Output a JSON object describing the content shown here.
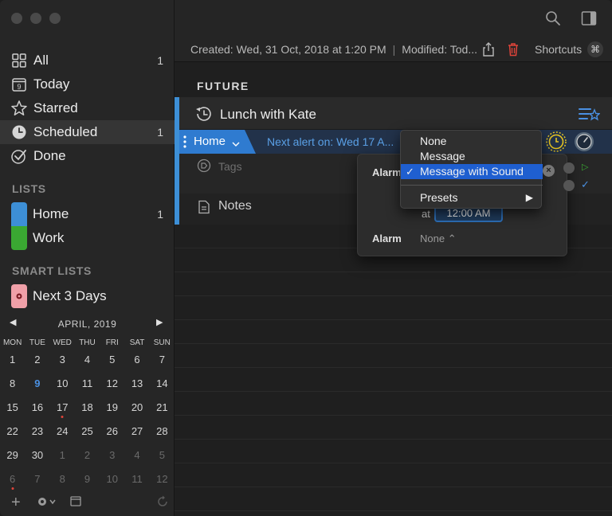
{
  "toolbar": {
    "add_icon": "plus-icon",
    "search_icon": "search-icon",
    "sidebar_toggle_icon": "sidebar-toggle-icon"
  },
  "sidebar": {
    "items": [
      {
        "label": "All",
        "count": "1",
        "icon": "grid-icon"
      },
      {
        "label": "Today",
        "count": "",
        "icon": "calendar-day-icon",
        "icon_text": "9"
      },
      {
        "label": "Starred",
        "count": "",
        "icon": "star-icon"
      },
      {
        "label": "Scheduled",
        "count": "1",
        "icon": "clock-icon"
      },
      {
        "label": "Done",
        "count": "",
        "icon": "checkmark-icon"
      }
    ],
    "lists_header": "LISTS",
    "lists": [
      {
        "label": "Home",
        "count": "1",
        "color": "#3d8fd6"
      },
      {
        "label": "Work",
        "count": "",
        "color": "#3aa832"
      }
    ],
    "smart_lists_header": "SMART LISTS",
    "smart_lists": [
      {
        "label": "Next 3 Days",
        "count": "",
        "color": "#f0a0a8"
      }
    ]
  },
  "calendar": {
    "title": "APRIL, 2019",
    "weekdays": [
      "MON",
      "TUE",
      "WED",
      "THU",
      "FRI",
      "SAT",
      "SUN"
    ],
    "weeks": [
      [
        "1",
        "2",
        "3",
        "4",
        "5",
        "6",
        "7"
      ],
      [
        "8",
        "9",
        "10",
        "11",
        "12",
        "13",
        "14"
      ],
      [
        "15",
        "16",
        "17",
        "18",
        "19",
        "20",
        "21"
      ],
      [
        "22",
        "23",
        "24",
        "25",
        "26",
        "27",
        "28"
      ],
      [
        "29",
        "30",
        "1",
        "2",
        "3",
        "4",
        "5"
      ],
      [
        "6",
        "7",
        "8",
        "9",
        "10",
        "11",
        "12"
      ]
    ],
    "today": "9"
  },
  "infobar": {
    "created": "Created: Wed, 31 Oct, 2018 at 1:20 PM",
    "separator": "|",
    "modified": "Modified: Tod...",
    "shortcuts": "Shortcuts",
    "shortcuts_key": "⌘"
  },
  "main": {
    "section_header": "FUTURE",
    "task": {
      "title": "Lunch with Kate",
      "list": "Home",
      "next_alert": "Next alert on: Wed 17 A...",
      "tags_placeholder": "Tags",
      "notes_label": "Notes"
    }
  },
  "popover": {
    "alarm_label_1": "Alarm",
    "at_label": "at",
    "time_value": "12:00 AM",
    "alarm_label_2": "Alarm",
    "alarm_value_2": "None ⌃"
  },
  "menu": {
    "items": [
      "None",
      "Message",
      "Message with Sound"
    ],
    "selected": "Message with Sound",
    "check": "✓",
    "presets": "Presets",
    "presets_arrow": "▶"
  }
}
